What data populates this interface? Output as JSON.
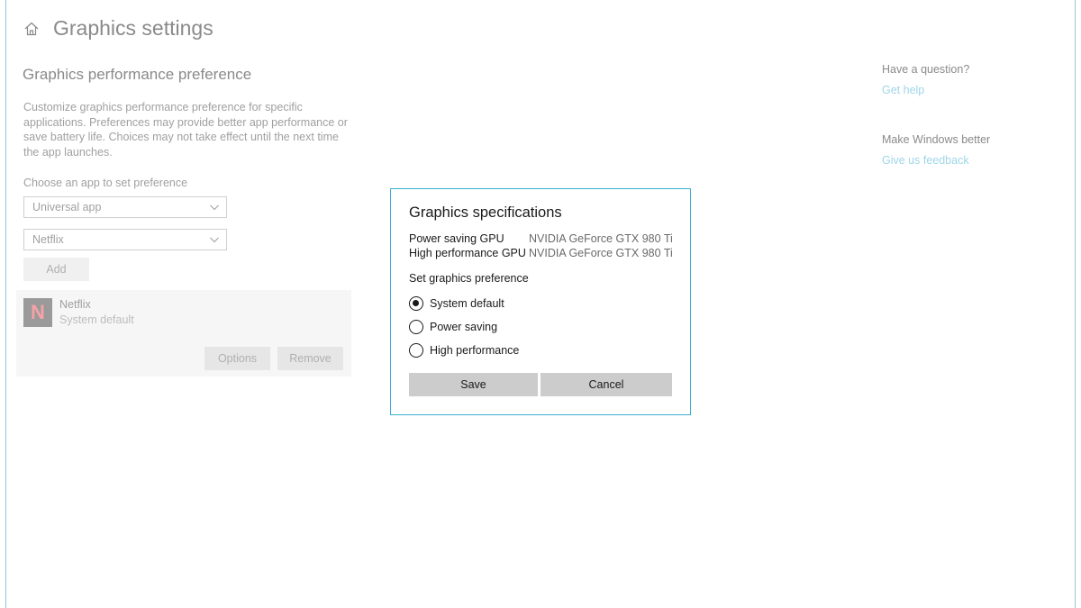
{
  "page": {
    "title": "Graphics settings",
    "section_title": "Graphics performance preference",
    "description": "Customize graphics performance preference for specific applications. Preferences may provide better app performance or save battery life. Choices may not take effect until the next time the app launches.",
    "choose_label": "Choose an app to set preference",
    "app_type_select": "Universal app",
    "app_select": "Netflix",
    "add_label": "Add"
  },
  "app_card": {
    "icon_letter": "N",
    "name": "Netflix",
    "preference": "System default",
    "options_label": "Options",
    "remove_label": "Remove"
  },
  "sidebar": {
    "question": "Have a question?",
    "help_link": "Get help",
    "improve": "Make Windows better",
    "feedback_link": "Give us feedback"
  },
  "dialog": {
    "title": "Graphics specifications",
    "specs": [
      {
        "label": "Power saving GPU",
        "value": "NVIDIA GeForce GTX 980 Ti"
      },
      {
        "label": "High performance GPU",
        "value": "NVIDIA GeForce GTX 980 Ti"
      }
    ],
    "pref_label": "Set graphics preference",
    "options": [
      {
        "label": "System default",
        "checked": true
      },
      {
        "label": "Power saving",
        "checked": false
      },
      {
        "label": "High performance",
        "checked": false
      }
    ],
    "save_label": "Save",
    "cancel_label": "Cancel"
  },
  "colors": {
    "accent": "#3bb0cf",
    "link": "#9fd6e8",
    "netflix_red": "#f5a3a8"
  }
}
